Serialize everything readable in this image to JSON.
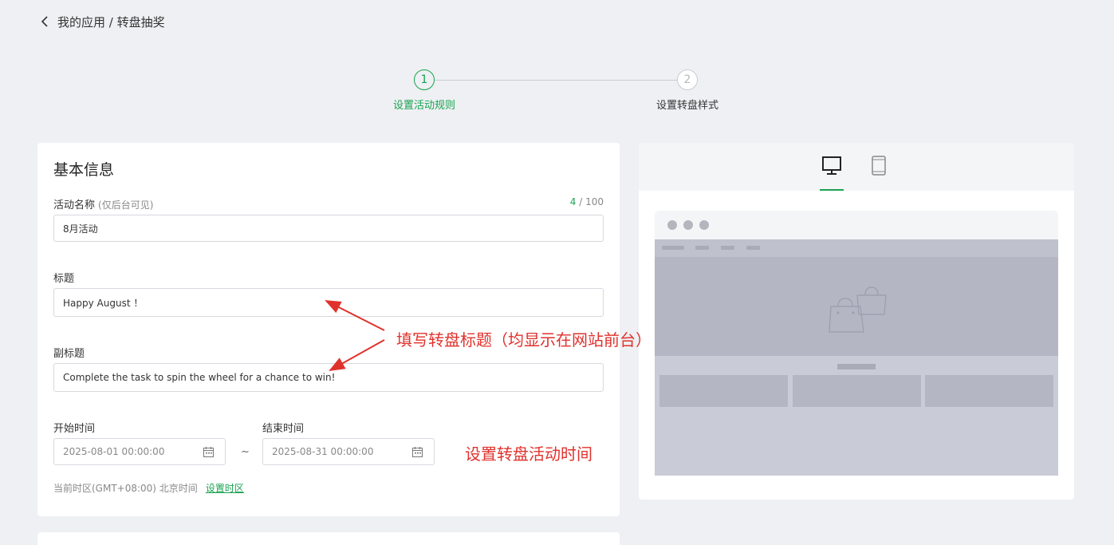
{
  "breadcrumb": {
    "text": "我的应用 / 转盘抽奖"
  },
  "steps": [
    {
      "number": "1",
      "label": "设置活动规则"
    },
    {
      "number": "2",
      "label": "设置转盘样式"
    }
  ],
  "basic_info": {
    "title": "基本信息",
    "activity_name": {
      "label": "活动名称",
      "hint": "(仅后台可见)",
      "value": "8月活动",
      "count_current": "4",
      "count_max": "/ 100"
    },
    "heading": {
      "label": "标题",
      "value": "Happy August ！"
    },
    "subheading": {
      "label": "副标题",
      "value": "Complete the task to spin the wheel for a chance to win!"
    },
    "start_time": {
      "label": "开始时间",
      "value": "2025-08-01 00:00:00"
    },
    "end_time": {
      "label": "结束时间",
      "value": "2025-08-31 00:00:00"
    },
    "separator": "~",
    "timezone": {
      "text": "当前时区(GMT+08:00) 北京时间",
      "link": "设置时区"
    }
  },
  "preview": {
    "tabs": [
      "desktop-icon",
      "tablet-icon"
    ],
    "active_tab": "desktop"
  },
  "annotations": {
    "title_note": "填写转盘标题（均显示在网站前台）",
    "time_note": "设置转盘活动时间"
  },
  "colors": {
    "accent": "#1aa351",
    "annotation": "#e0322d",
    "background": "#eef0f3"
  }
}
